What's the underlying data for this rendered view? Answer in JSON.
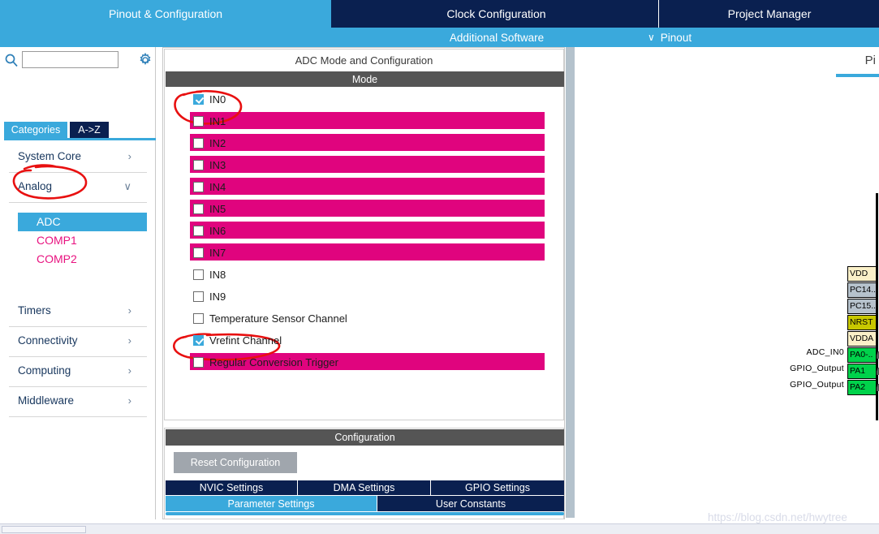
{
  "tabs": {
    "pinout_config": "Pinout & Configuration",
    "clock_config": "Clock Configuration",
    "project_manager": "Project Manager",
    "additional_software": "Additional Software",
    "pinout": "Pinout",
    "chevron": "∨"
  },
  "sidebar": {
    "search_placeholder": "",
    "search_value": "",
    "search_icon": "search-icon",
    "gear_icon": "gear-icon",
    "view_tabs": [
      {
        "label": "Categories",
        "active": true
      },
      {
        "label": "A->Z",
        "active": false
      }
    ],
    "groups": [
      {
        "label": "System Core",
        "arrow": "›",
        "expanded": false
      },
      {
        "label": "Analog",
        "arrow": "∨",
        "expanded": true
      },
      {
        "label": "Timers",
        "arrow": "›",
        "expanded": false
      },
      {
        "label": "Connectivity",
        "arrow": "›",
        "expanded": false
      },
      {
        "label": "Computing",
        "arrow": "›",
        "expanded": false
      },
      {
        "label": "Middleware",
        "arrow": "›",
        "expanded": false
      }
    ],
    "analog_items": [
      {
        "label": "ADC",
        "selected": true
      },
      {
        "label": "COMP1",
        "selected": false
      },
      {
        "label": "COMP2",
        "selected": false
      }
    ]
  },
  "center": {
    "panel_title": "ADC Mode and Configuration",
    "mode_header": "Mode",
    "channels": [
      {
        "label": "IN0",
        "checked": true,
        "highlighted": false
      },
      {
        "label": "IN1",
        "checked": false,
        "highlighted": true
      },
      {
        "label": "IN2",
        "checked": false,
        "highlighted": true
      },
      {
        "label": "IN3",
        "checked": false,
        "highlighted": true
      },
      {
        "label": "IN4",
        "checked": false,
        "highlighted": true
      },
      {
        "label": "IN5",
        "checked": false,
        "highlighted": true
      },
      {
        "label": "IN6",
        "checked": false,
        "highlighted": true
      },
      {
        "label": "IN7",
        "checked": false,
        "highlighted": true
      },
      {
        "label": "IN8",
        "checked": false,
        "highlighted": false
      },
      {
        "label": "IN9",
        "checked": false,
        "highlighted": false
      },
      {
        "label": "Temperature Sensor Channel",
        "checked": false,
        "highlighted": false
      },
      {
        "label": "Vrefint Channel",
        "checked": true,
        "highlighted": false
      },
      {
        "label": "Regular Conversion Trigger",
        "checked": false,
        "highlighted": true
      }
    ],
    "config_header": "Configuration",
    "reset_button": "Reset Configuration",
    "settings_tabs_row1": [
      {
        "label": "NVIC Settings",
        "active": false
      },
      {
        "label": "DMA Settings",
        "active": false
      },
      {
        "label": "GPIO Settings",
        "active": false
      }
    ],
    "settings_tabs_row2": [
      {
        "label": "Parameter Settings",
        "active": true
      },
      {
        "label": "User Constants",
        "active": false
      }
    ]
  },
  "pinview": {
    "title": "Pi",
    "pins": [
      {
        "name": "VDD",
        "style": "vdd",
        "signal": ""
      },
      {
        "name": "PC14..",
        "style": "gray",
        "signal": ""
      },
      {
        "name": "PC15..",
        "style": "gray",
        "signal": ""
      },
      {
        "name": "NRST",
        "style": "nrst",
        "signal": ""
      },
      {
        "name": "VDDA",
        "style": "vdd",
        "signal": ""
      },
      {
        "name": "PA0-..",
        "style": "green",
        "signal": "ADC_IN0"
      },
      {
        "name": "PA1",
        "style": "green",
        "signal": "GPIO_Output"
      },
      {
        "name": "PA2",
        "style": "green",
        "signal": "GPIO_Output"
      }
    ]
  },
  "watermark": "https://blog.csdn.net/hwytree"
}
